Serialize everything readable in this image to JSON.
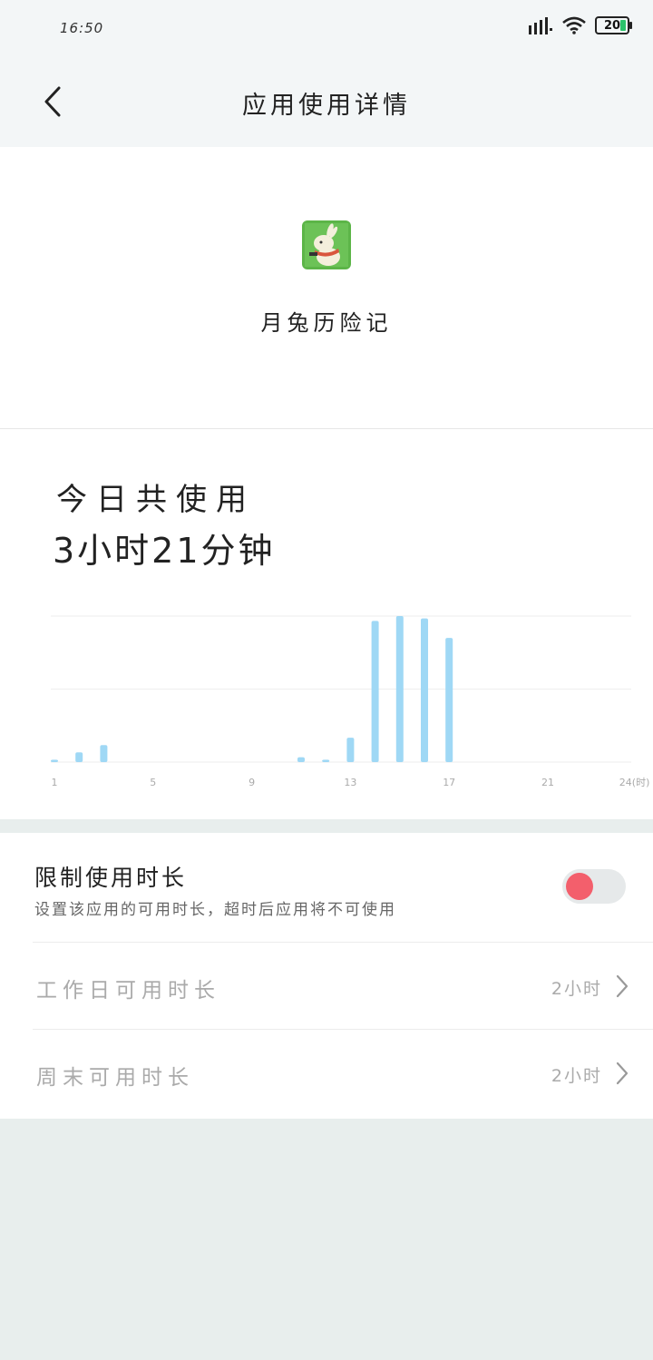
{
  "status_bar": {
    "time": "16:50",
    "battery": "20"
  },
  "header": {
    "title": "应用使用详情"
  },
  "app": {
    "name": "月兔历险记"
  },
  "usage": {
    "label": "今日共使用",
    "value": "3小时21分钟"
  },
  "chart_data": {
    "type": "bar",
    "x_tick_labels": [
      "1",
      "5",
      "9",
      "13",
      "17",
      "21",
      "24(时)"
    ],
    "x": [
      1,
      2,
      3,
      11,
      12,
      13,
      14,
      15,
      16,
      17
    ],
    "values": [
      1,
      4,
      7,
      2,
      1,
      10,
      58,
      60,
      59,
      51
    ],
    "xlim": [
      1,
      24
    ],
    "ylim": [
      0,
      60
    ],
    "grid": true,
    "color": "#9fd8f5"
  },
  "limit": {
    "title": "限制使用时长",
    "description": "设置该应用的可用时长，超时后应用将不可使用",
    "enabled": false,
    "toggle_color": "#f35f6c"
  },
  "rows": [
    {
      "label": "工作日可用时长",
      "value": "2小时"
    },
    {
      "label": "周末可用时长",
      "value": "2小时"
    }
  ]
}
